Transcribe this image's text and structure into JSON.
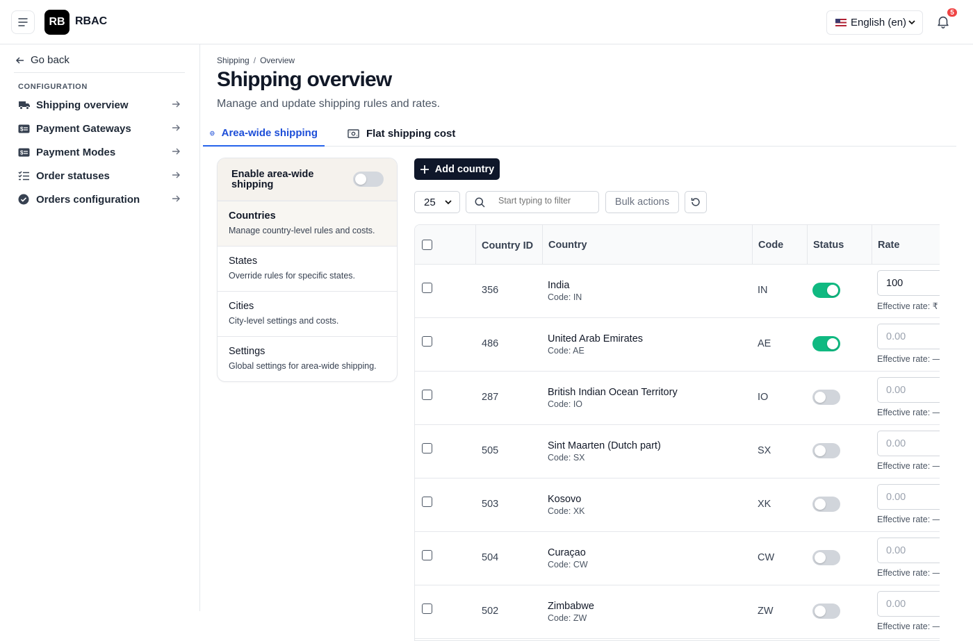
{
  "app": {
    "logo": "RB",
    "name": "RBAC"
  },
  "header": {
    "language": "English (en)",
    "notifications": "5"
  },
  "sidebar": {
    "back": "Go back",
    "heading": "CONFIGURATION",
    "items": [
      {
        "label": "Shipping overview",
        "icon": "truck-icon"
      },
      {
        "label": "Payment Gateways",
        "icon": "money-icon"
      },
      {
        "label": "Payment Modes",
        "icon": "money-icon"
      },
      {
        "label": "Order statuses",
        "icon": "list-check-icon"
      },
      {
        "label": "Orders configuration",
        "icon": "check-circle-icon"
      }
    ]
  },
  "breadcrumb": {
    "parent": "Shipping",
    "sep": "/",
    "current": "Overview"
  },
  "page": {
    "title": "Shipping overview",
    "subtitle": "Manage and update shipping rules and rates."
  },
  "tabs": [
    {
      "label": "Area-wide shipping",
      "active": true
    },
    {
      "label": "Flat shipping cost",
      "active": false
    }
  ],
  "panel": {
    "title": "Enable area-wide shipping",
    "enabled": false,
    "items": [
      {
        "title": "Countries",
        "desc": "Manage country-level rules and costs."
      },
      {
        "title": "States",
        "desc": "Override rules for specific states."
      },
      {
        "title": "Cities",
        "desc": "City-level settings and costs."
      },
      {
        "title": "Settings",
        "desc": "Global settings for area-wide shipping."
      }
    ]
  },
  "toolbar": {
    "add": "Add country",
    "page_size": "25",
    "filter_placeholder": "Start typing to filter",
    "bulk": "Bulk actions"
  },
  "table": {
    "headers": {
      "id": "Country ID",
      "country": "Country",
      "code": "Code",
      "status": "Status",
      "rate": "Rate"
    },
    "rows": [
      {
        "id": "356",
        "name": "India",
        "sub": "Code: IN",
        "code": "IN",
        "on": true,
        "rate": "100",
        "placeholder": "",
        "eff": "Effective rate: ₹"
      },
      {
        "id": "486",
        "name": "United Arab Emirates",
        "sub": "Code: AE",
        "code": "AE",
        "on": true,
        "rate": "",
        "placeholder": "0.00",
        "eff": "Effective rate: —"
      },
      {
        "id": "287",
        "name": "British Indian Ocean Territory",
        "sub": "Code: IO",
        "code": "IO",
        "on": false,
        "rate": "",
        "placeholder": "0.00",
        "eff": "Effective rate: —"
      },
      {
        "id": "505",
        "name": "Sint Maarten (Dutch part)",
        "sub": "Code: SX",
        "code": "SX",
        "on": false,
        "rate": "",
        "placeholder": "0.00",
        "eff": "Effective rate: —"
      },
      {
        "id": "503",
        "name": "Kosovo",
        "sub": "Code: XK",
        "code": "XK",
        "on": false,
        "rate": "",
        "placeholder": "0.00",
        "eff": "Effective rate: —"
      },
      {
        "id": "504",
        "name": "Curaçao",
        "sub": "Code: CW",
        "code": "CW",
        "on": false,
        "rate": "",
        "placeholder": "0.00",
        "eff": "Effective rate: —"
      },
      {
        "id": "502",
        "name": "Zimbabwe",
        "sub": "Code: ZW",
        "code": "ZW",
        "on": false,
        "rate": "",
        "placeholder": "0.00",
        "eff": "Effective rate: —"
      }
    ]
  }
}
